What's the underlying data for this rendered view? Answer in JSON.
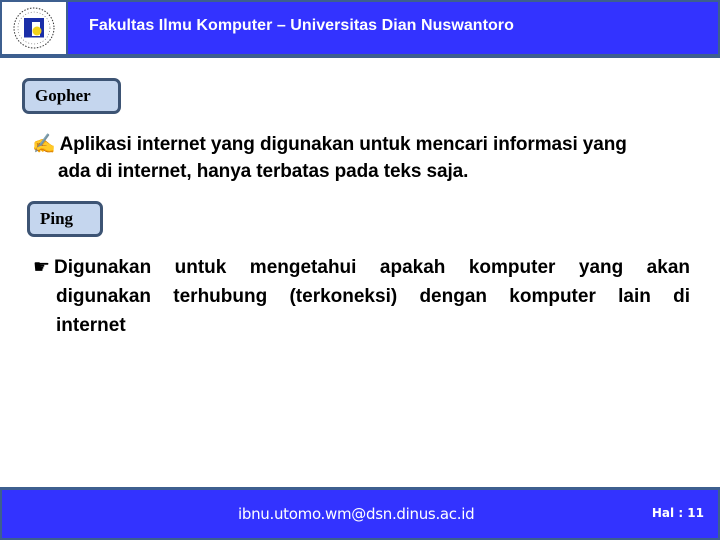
{
  "header": {
    "title": "Fakultas Ilmu Komputer – Universitas Dian Nuswantoro",
    "logo_icon": "university-seal-icon"
  },
  "sections": [
    {
      "label": "Gopher",
      "bullet_icon": "writing-hand-icon",
      "bullet_glyph": "✍",
      "lines": [
        "Aplikasi internet yang digunakan untuk mencari informasi yang",
        "ada di internet, hanya terbatas pada teks saja."
      ]
    },
    {
      "label": "Ping",
      "bullet_icon": "pointing-hand-icon",
      "bullet_glyph": "☛",
      "lines": [
        "Digunakan untuk mengetahui apakah komputer yang akan",
        "digunakan terhubung (terkoneksi) dengan komputer lain di",
        "internet"
      ]
    }
  ],
  "footer": {
    "email": "ibnu.utomo.wm@dsn.dinus.ac.id",
    "page_label": "Hal : 11"
  },
  "colors": {
    "header_blue": "#3333ff",
    "border_slate": "#3d5f8f",
    "label_fill": "#c5d6ee",
    "label_border": "#3d5474"
  }
}
